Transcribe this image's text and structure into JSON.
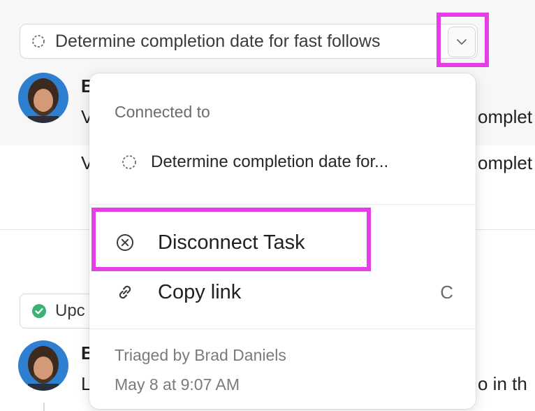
{
  "task_chip": {
    "label": "Determine completion date for fast follows",
    "status_icon": "dashed-circle-icon"
  },
  "chevron_button": {
    "icon": "chevron-down-icon"
  },
  "feed": {
    "comment1": {
      "author_initial": "B",
      "line1_left": "V",
      "line1_right": "omplet",
      "line2_left": "V",
      "line2_right": "omplet"
    },
    "status_chip": {
      "label": "Upc",
      "icon": "check-circle-icon",
      "color": "#3bb273"
    },
    "comment2": {
      "author_initial": "B",
      "line_left": "L",
      "line_right": "o in th"
    }
  },
  "menu": {
    "section_label": "Connected to",
    "connected_task": "Determine completion date for...",
    "items": [
      {
        "label": "Disconnect Task",
        "icon": "x-circle-icon",
        "shortcut": ""
      },
      {
        "label": "Copy link",
        "icon": "link-icon",
        "shortcut": "C"
      }
    ],
    "meta_line1": "Triaged by Brad Daniels",
    "meta_line2": "May 8 at 9:07 AM"
  },
  "highlight_color": "#e63ee6"
}
